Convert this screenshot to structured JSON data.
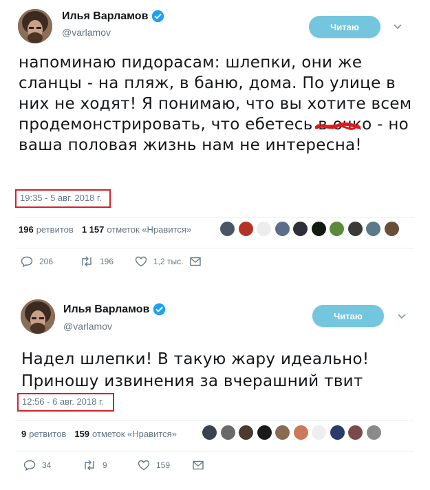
{
  "tweets": [
    {
      "author_name": "Илья Варламов",
      "handle": "@varlamov",
      "follow_label": "Читаю",
      "text": "напоминаю пидорасам: шлепки, они же сланцы - на пляж, в баню, дома. По улице в них не ходят! Я понимаю, что вы хотите всем продемонстрировать, что ебетесь в очко - но ваша половая жизнь нам не интересна!",
      "timestamp": "19:35 - 5 авг. 2018 г.",
      "retweets_count": "196",
      "retweets_label": "ретвитов",
      "likes_count": "1 157",
      "likes_label": "отметок «Нравится»",
      "replies": "206",
      "retweets": "196",
      "likes": "1,2 тыс.",
      "liker_colors": [
        "#4a5566",
        "#b53326",
        "#ececec",
        "#5a6d8a",
        "#2f2f3a",
        "#111a11",
        "#5a8a3a",
        "#3a3a3a",
        "#5a7a88",
        "#6a4e3a"
      ]
    },
    {
      "author_name": "Илья Варламов",
      "handle": "@varlamov",
      "follow_label": "Читаю",
      "text": "Надел шлепки! В такую жару идеально! Приношу извинения за вчерашний твит",
      "timestamp": "12:56 - 6 авг. 2018 г.",
      "retweets_count": "9",
      "retweets_label": "ретвитов",
      "likes_count": "159",
      "likes_label": "отметок «Нравится»",
      "replies": "34",
      "retweets": "9",
      "likes": "159",
      "liker_colors": [
        "#3a4250",
        "#6a6a6a",
        "#4a3a30",
        "#1a1a1a",
        "#8a6a50",
        "#c87a5a",
        "#eeeeee",
        "#2a3a6a",
        "#7a4a4a",
        "#8a8a8a"
      ]
    }
  ],
  "colors": {
    "follow_button": "#73c6dd",
    "verified": "#1da1f2",
    "timestamp_box": "#d6202a",
    "scribble": "#e01a1a",
    "muted_text": "#657786"
  },
  "icons": [
    "verified-icon",
    "caret-down-icon",
    "reply-icon",
    "retweet-icon",
    "like-icon",
    "message-icon"
  ]
}
